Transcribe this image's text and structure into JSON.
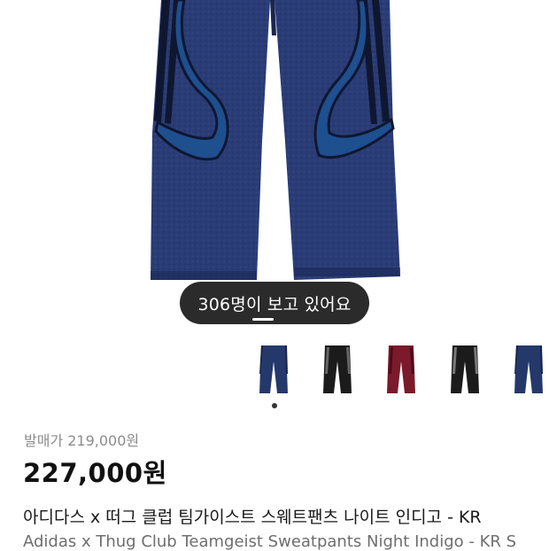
{
  "viewer_badge": "306명이 보고 있어요",
  "release_price": "발매가 219,000원",
  "current_price": "227,000원",
  "title_ko": "아디다스 x 떠그 클럽 팀가이스트 스웨트팬츠 나이트 인디고 - KR",
  "title_en": "Adidas x Thug Club Teamgeist Sweatpants Night Indigo - KR S",
  "thumbnails": [
    {
      "color": "#24386a",
      "accent": "#16224a"
    },
    {
      "color": "#1b1b1b",
      "accent": "#444444"
    },
    {
      "color": "#7a1a2b",
      "accent": "#5a0f1e"
    },
    {
      "color": "#1b1b1b",
      "accent": "#555555"
    },
    {
      "color": "#24386a",
      "accent": "#16224a"
    }
  ],
  "colors": {
    "denim": "#283a73",
    "denim_dark": "#1a2652",
    "stripe": "#0f1730",
    "panel": "#1e4f8f"
  }
}
